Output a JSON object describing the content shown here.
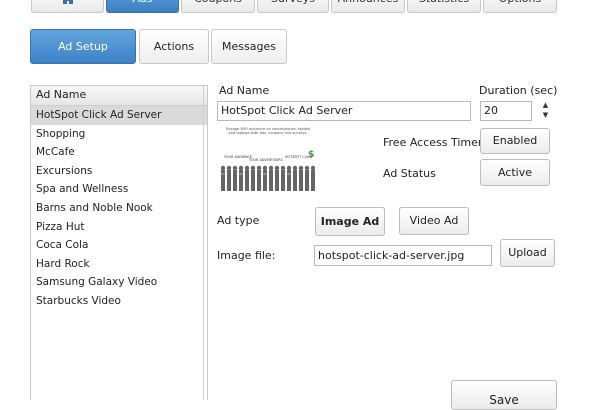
{
  "top_tabs": [
    {
      "label": ""
    },
    {
      "label": "Ads"
    },
    {
      "label": "Coupons"
    },
    {
      "label": "Surveys"
    },
    {
      "label": "Announces"
    },
    {
      "label": "Statistics"
    },
    {
      "label": "Options"
    }
  ],
  "sub_tabs": [
    {
      "label": "Ad Setup"
    },
    {
      "label": "Actions"
    },
    {
      "label": "Messages"
    }
  ],
  "ad_list": {
    "header": "Ad Name",
    "items": [
      "HotSpot Click Ad Server",
      "Shopping",
      "McCafe",
      "Excursions",
      "Spa and Wellness",
      "Barns and Noble Nook",
      "Pizza Hut",
      "Coca Cola",
      "Hard Rock",
      "Samsung Galaxy Video",
      "Starbucks Video"
    ]
  },
  "form": {
    "ad_name_label": "Ad Name",
    "ad_name_value": "HotSpot Click Ad Server",
    "duration_label": "Duration (sec)",
    "duration_value": "20",
    "free_access_label": "Free Access Timer",
    "free_access_button": "Enabled",
    "ad_status_label": "Ad Status",
    "ad_status_button": "Active",
    "ad_type_label": "Ad type",
    "image_ad_button": "Image Ad",
    "video_ad_button": "Video Ad",
    "image_file_label": "Image file:",
    "image_file_value": "hotspot-click-ad-server.jpg",
    "upload_button": "Upload",
    "save_button": "Save"
  },
  "thumbnail": {
    "caption": "Engage WiFi audience on smartphones, tablets and laptops with ads, coupons and surveys.",
    "flow": [
      "YOUR AUDIENCE",
      "YOUR ADVERTISERS",
      "HOTSPOT CLICK"
    ],
    "symbol": "$"
  },
  "colors": {
    "accent": "#4a8fd4",
    "selected_row": "#dadada"
  }
}
